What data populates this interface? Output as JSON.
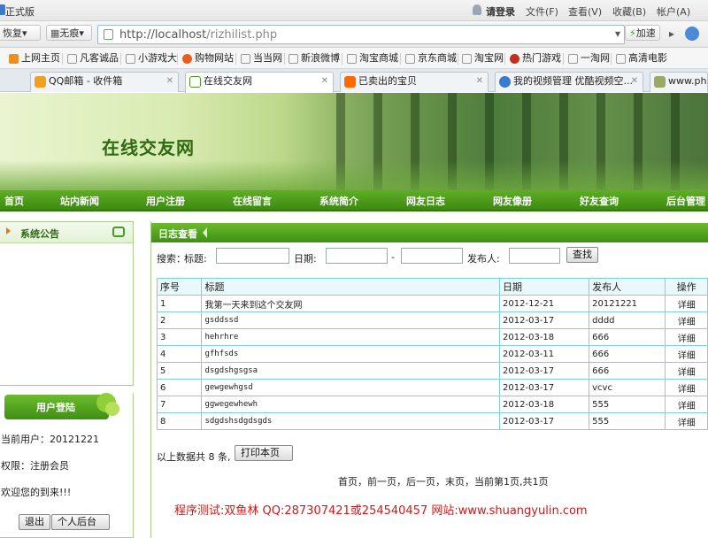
{
  "browser": {
    "title_partial": "正式版",
    "login": "请登录",
    "menu": [
      "文件(F)",
      "查看(V)",
      "收藏(B)",
      "帐户(A)"
    ],
    "back_label": "恢复",
    "traceless_label": "无痕",
    "url_host": "http://localhost",
    "url_path": "/rizhilist.php",
    "accelerate": "加速",
    "favorites": [
      "上网主页",
      "凡客诚品",
      "小游戏大",
      "购物网站",
      "当当网",
      "新浪微博",
      "淘宝商城",
      "京东商城",
      "淘宝网",
      "热门游戏",
      "一淘网",
      "高清电影"
    ],
    "tabs": [
      {
        "label": "QQ邮箱 - 收件箱",
        "color": "#f0a020"
      },
      {
        "label": "在线交友网",
        "color": "#4a9a2a",
        "active": true
      },
      {
        "label": "已卖出的宝贝",
        "color": "#ff6a00"
      },
      {
        "label": "我的视频管理 优酷视频空...",
        "color": "#3a7ad0"
      },
      {
        "label": "www.php",
        "color": "#9a6"
      }
    ]
  },
  "site": {
    "banner_title": "在线交友网",
    "nav": [
      "首页",
      "站内新闻",
      "用户注册",
      "在线留言",
      "系统简介",
      "网友日志",
      "网友像册",
      "好友查询",
      "后台管理"
    ]
  },
  "sidebar": {
    "announce_title": "系统公告",
    "login_title": "用户登陆",
    "current_user": "当前用户：20121221",
    "permission": "权限：注册会员",
    "welcome": "欢迎您的到来!!!",
    "logout": "退出",
    "personal": "个人后台"
  },
  "main": {
    "section_title": "日志查看",
    "search": {
      "label": "搜索：",
      "title_label": "标题:",
      "date_label": "日期:",
      "dash": "-",
      "publisher_label": "发布人:",
      "button": "查找"
    },
    "table": {
      "headers": [
        "序号",
        "标题",
        "日期",
        "发布人",
        "操作"
      ],
      "rows": [
        [
          "1",
          "我第一天来到这个交友网",
          "2012-12-21",
          "20121221",
          "详细"
        ],
        [
          "2",
          "gsddssd",
          "2012-03-17",
          "dddd",
          "详细"
        ],
        [
          "3",
          "hehrhre",
          "2012-03-18",
          "666",
          "详细"
        ],
        [
          "4",
          "gfhfsds",
          "2012-03-11",
          "666",
          "详细"
        ],
        [
          "5",
          "dsgdshgsgsa",
          "2012-03-17",
          "666",
          "详细"
        ],
        [
          "6",
          "gewgewhgsd",
          "2012-03-17",
          "vcvc",
          "详细"
        ],
        [
          "7",
          "ggwegewhewh",
          "2012-03-18",
          "555",
          "详细"
        ],
        [
          "8",
          "sdgdshsdgdsgds",
          "2012-03-17",
          "555",
          "详细"
        ]
      ]
    },
    "total_prefix": "以上数据共",
    "total_count": "8",
    "total_suffix": "条,",
    "print_button": "打印本页",
    "pager": "首页，前一页，后一页，末页，当前第1页,共1页",
    "footer": "程序测试:双鱼林 QQ:287307421或254540457 网站:www.shuangyulin.com"
  },
  "colors": {
    "accent_green": "#3d8a12",
    "footer_red": "#d01818",
    "table_border": "#7fd0d8"
  }
}
